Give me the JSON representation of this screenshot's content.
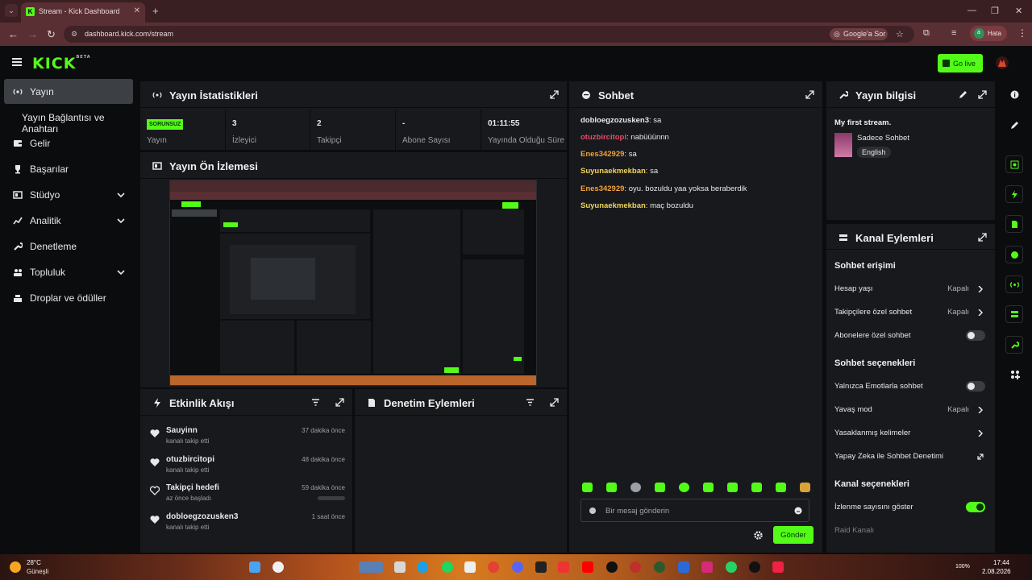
{
  "browser": {
    "tab_title": "Stream - Kick Dashboard",
    "url": "dashboard.kick.com/stream",
    "search_pill": "Google'a Sor",
    "profile_status": "Hata",
    "profile_initial": "a"
  },
  "header": {
    "logo": "KICK",
    "logo_badge": "BETA",
    "go_live_label": "Go live"
  },
  "sidebar": {
    "items": [
      {
        "label": "Yayın",
        "icon": "broadcast-icon",
        "active": true
      },
      {
        "label": "Yayın Bağlantısı ve Anahtarı",
        "icon": "",
        "active": false
      },
      {
        "label": "Gelir",
        "icon": "wallet-icon",
        "active": false
      },
      {
        "label": "Başarılar",
        "icon": "trophy-icon",
        "active": false
      },
      {
        "label": "Stüdyo",
        "icon": "studio-icon",
        "active": false,
        "expandable": true
      },
      {
        "label": "Analitik",
        "icon": "analytics-icon",
        "active": false,
        "expandable": true
      },
      {
        "label": "Denetleme",
        "icon": "wrench-icon",
        "active": false
      },
      {
        "label": "Topluluk",
        "icon": "community-icon",
        "active": false,
        "expandable": true
      },
      {
        "label": "Droplar ve ödüller",
        "icon": "drops-icon",
        "active": false
      }
    ]
  },
  "stats": {
    "title": "Yayın İstatistikleri",
    "status_badge": "SORUNSUZ",
    "cells": [
      {
        "value": "",
        "label": "Yayın"
      },
      {
        "value": "3",
        "label": "İzleyici"
      },
      {
        "value": "2",
        "label": "Takipçi"
      },
      {
        "value": "-",
        "label": "Abone Sayısı"
      },
      {
        "value": "01:11:55",
        "label": "Yayında Olduğu Süre"
      }
    ]
  },
  "preview": {
    "title": "Yayın Ön İzlemesi"
  },
  "activity": {
    "title": "Etkinlik Akışı",
    "items": [
      {
        "name": "Sauyinn",
        "sub": "kanalı takip etti",
        "time": "37 dakika önce",
        "filled": true
      },
      {
        "name": "otuzbircitopi",
        "sub": "kanalı takip etti",
        "time": "48 dakika önce",
        "filled": true
      },
      {
        "name": "Takipçi hedefi",
        "sub": "az önce başladı",
        "time": "59 dakika önce",
        "filled": false
      },
      {
        "name": "dobloegzozusken3",
        "sub": "kanalı takip etti",
        "time": "1 saat önce",
        "filled": true
      }
    ]
  },
  "moderation": {
    "title": "Denetim Eylemleri"
  },
  "chat": {
    "title": "Sohbet",
    "messages": [
      {
        "user": "dobloegzozusken3",
        "text": "sa",
        "color": "#e8e8e8"
      },
      {
        "user": "otuzbircitopi",
        "text": "nabüüünnn",
        "color": "#e8496b"
      },
      {
        "user": "Enes342929",
        "text": "sa",
        "color": "#f0a23a"
      },
      {
        "user": "Suyunaekmekban",
        "text": "sa",
        "color": "#f0d45a"
      },
      {
        "user": "Enes342929",
        "text": "oyu. bozuldu yaa yoksa beraberdik",
        "color": "#f0a23a"
      },
      {
        "user": "Suyunaekmekban",
        "text": "maç bozuldu",
        "color": "#f0d45a"
      }
    ],
    "input_placeholder": "Bir mesaj gönderin",
    "send_label": "Gönder"
  },
  "stream_info": {
    "title": "Yayın bilgisi",
    "stream_title": "My first stream.",
    "category": "Sadece Sohbet",
    "language": "English"
  },
  "channel_actions": {
    "title": "Kanal Eylemleri",
    "chat_access_heading": "Sohbet erişimi",
    "chat_access": [
      {
        "label": "Hesap yaşı",
        "value": "Kapalı",
        "type": "link"
      },
      {
        "label": "Takipçilere özel sohbet",
        "value": "Kapalı",
        "type": "link"
      },
      {
        "label": "Abonelere özel sohbet",
        "value": "",
        "type": "toggle",
        "on": false
      }
    ],
    "chat_options_heading": "Sohbet seçenekleri",
    "chat_options": [
      {
        "label": "Yalnızca Emotlarla sohbet",
        "value": "",
        "type": "toggle",
        "on": false
      },
      {
        "label": "Yavaş mod",
        "value": "Kapalı",
        "type": "link"
      },
      {
        "label": "Yasaklanmış kelimeler",
        "value": "",
        "type": "link"
      },
      {
        "label": "Yapay Zeka ile Sohbet Denetimi",
        "value": "",
        "type": "external"
      }
    ],
    "channel_options_heading": "Kanal seçenekleri",
    "channel_options": [
      {
        "label": "İzlenme sayısını göster",
        "value": "",
        "type": "toggle",
        "on": true
      },
      {
        "label": "Raid Kanalı",
        "value": "",
        "type": "disabled"
      }
    ]
  },
  "taskbar": {
    "weather_temp": "28°C",
    "weather_desc": "Güneşli",
    "battery": "100%",
    "time": "17:44",
    "date": "2.08.2026"
  },
  "colors": {
    "accent": "#53fc18",
    "panel": "#18191c",
    "background": "#0b0c0d"
  }
}
